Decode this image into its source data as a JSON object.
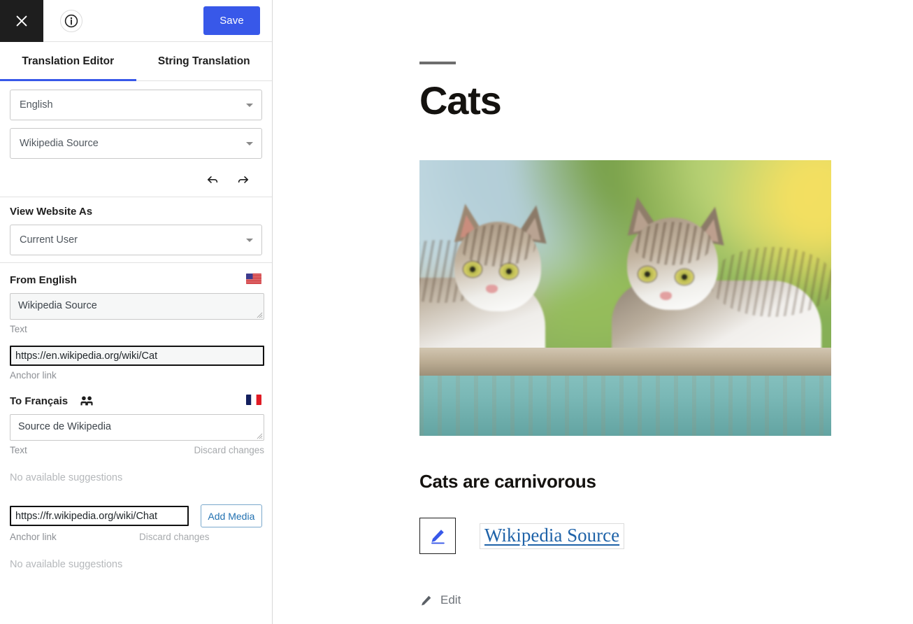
{
  "topbar": {
    "close_icon": "close-icon",
    "info_icon": "info-icon",
    "save_label": "Save"
  },
  "tabs": [
    {
      "label": "Translation Editor",
      "active": true
    },
    {
      "label": "String Translation",
      "active": false
    }
  ],
  "selectors": {
    "language": {
      "value": "English",
      "caret_icon": "chevron-down-icon"
    },
    "string": {
      "value": "Wikipedia Source",
      "caret_icon": "chevron-down-icon"
    },
    "undo_icon": "undo-arrow-icon",
    "redo_icon": "redo-arrow-icon"
  },
  "view_website_as": {
    "title": "View Website As",
    "value": "Current User",
    "caret_icon": "chevron-down-icon"
  },
  "source_pane": {
    "heading": "From English",
    "flag_icon": "flag-us-icon",
    "text_value": "Wikipedia Source",
    "text_label": "Text",
    "anchor_value": "https://en.wikipedia.org/wiki/Cat",
    "anchor_label": "Anchor link"
  },
  "target_pane": {
    "heading": "To Français",
    "people_icon": "people-icon",
    "flag_icon": "flag-fr-icon",
    "text_value": "Source de Wikipedia",
    "text_label": "Text",
    "discard_text_label": "Discard changes",
    "no_suggestions_text": "No available suggestions",
    "anchor_value": "https://fr.wikipedia.org/wiki/Chat",
    "anchor_label": "Anchor link",
    "discard_anchor_label": "Discard changes",
    "no_suggestions_anchor": "No available suggestions",
    "add_media_label": "Add Media"
  },
  "content": {
    "page_title": "Cats",
    "image_alt": "Two tabby and white cats resting on a weathered teal wooden ledge with blurred green foliage behind",
    "section_heading": "Cats are carnivorous",
    "pencil_icon": "pencil-edit-icon",
    "link_text": "Wikipedia Source",
    "edit_icon": "pencil-icon",
    "edit_label": "Edit"
  },
  "colors": {
    "accent_blue": "#3858e9",
    "dark": "#1e1e1e",
    "link_blue": "#1e62a8",
    "muted": "#8c8f94"
  }
}
